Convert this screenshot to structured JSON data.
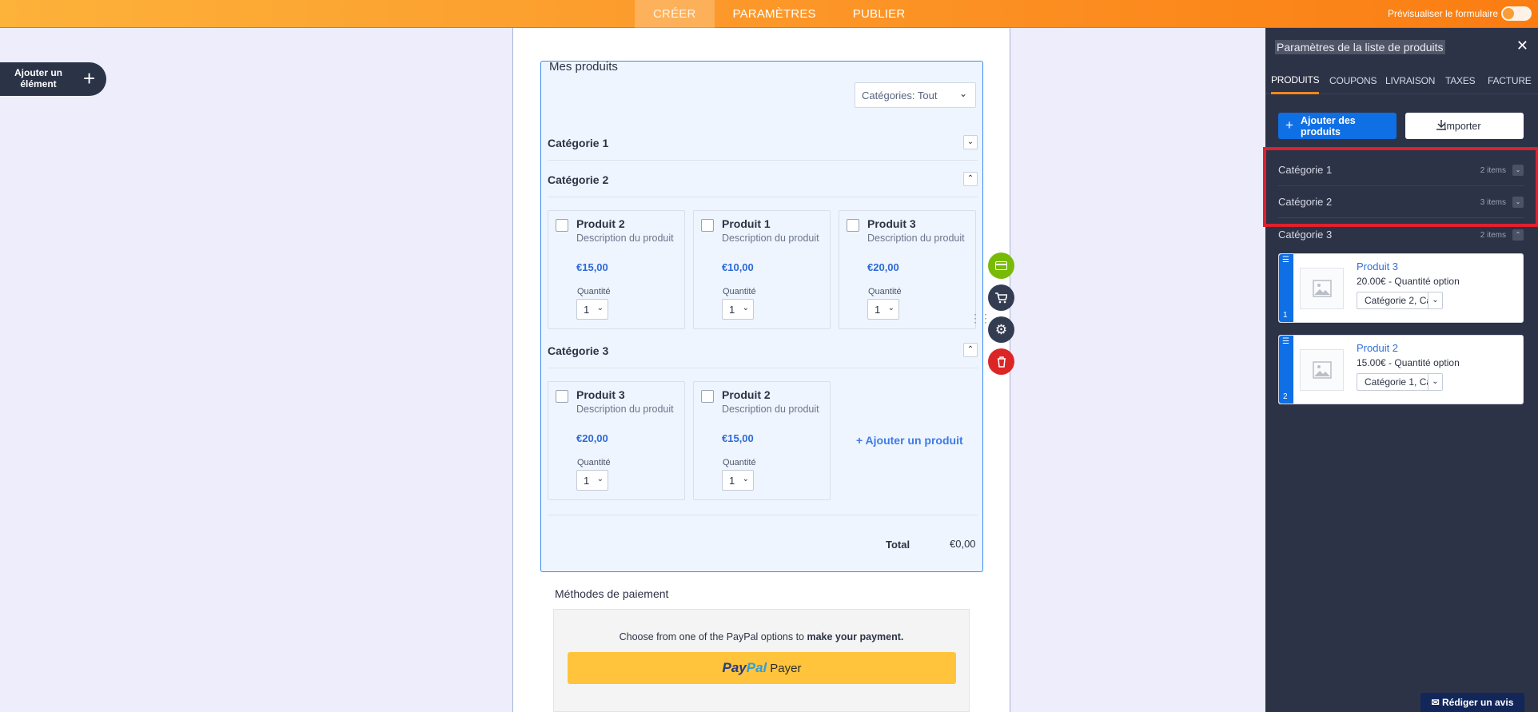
{
  "topbar": {
    "tabs": [
      {
        "label": "CRÉER",
        "active": true
      },
      {
        "label": "PARAMÈTRES",
        "active": false
      },
      {
        "label": "PUBLIER",
        "active": false
      }
    ],
    "preview_label": "Prévisualiser le formulaire",
    "gradient": [
      "#fdb23a",
      "#fb7d12"
    ]
  },
  "add_element": {
    "label": "Ajouter un élément",
    "icon": "plus-icon"
  },
  "widget": {
    "title": "Mes produits",
    "category_filter": "Catégories: Tout",
    "categories": [
      {
        "name": "Catégorie 1",
        "expanded": false,
        "products": []
      },
      {
        "name": "Catégorie 2",
        "expanded": true,
        "products": [
          {
            "name": "Produit 2",
            "description": "Description du produit",
            "price": "€15,00",
            "quantity_label": "Quantité",
            "quantity": "1"
          },
          {
            "name": "Produit 1",
            "description": "Description du produit",
            "price": "€10,00",
            "quantity_label": "Quantité",
            "quantity": "1"
          },
          {
            "name": "Produit 3",
            "description": "Description du produit",
            "price": "€20,00",
            "quantity_label": "Quantité",
            "quantity": "1"
          }
        ]
      },
      {
        "name": "Catégorie 3",
        "expanded": true,
        "products": [
          {
            "name": "Produit 3",
            "description": "Description du produit",
            "price": "€20,00",
            "quantity_label": "Quantité",
            "quantity": "1"
          },
          {
            "name": "Produit 2",
            "description": "Description du produit",
            "price": "€15,00",
            "quantity_label": "Quantité",
            "quantity": "1"
          }
        ]
      }
    ],
    "add_product": "+ Ajouter un produit",
    "total_label": "Total",
    "total_value": "€0,00"
  },
  "side_tools": [
    {
      "icon": "card-icon",
      "color": "#78bb07"
    },
    {
      "icon": "cart-icon",
      "color": "#343c52"
    },
    {
      "icon": "gear-icon",
      "color": "#343c52"
    },
    {
      "icon": "trash-icon",
      "color": "#dc2626"
    }
  ],
  "payment": {
    "title": "Méthodes de paiement",
    "text_prefix": "Choose from one of the PayPal options to ",
    "text_bold": "make your payment.",
    "paypal_brand_1": "Pay",
    "paypal_brand_2": "Pal",
    "paypal_action": "Payer",
    "button_color": "#ffc43b"
  },
  "panel": {
    "title": "Paramètres de la liste de produits",
    "tabs": [
      {
        "label": "PRODUITS",
        "active": true
      },
      {
        "label": "COUPONS",
        "active": false
      },
      {
        "label": "LIVRAISON",
        "active": false
      },
      {
        "label": "TAXES",
        "active": false
      },
      {
        "label": "FACTURE",
        "active": false
      }
    ],
    "add_products_label": "Ajouter des produits",
    "import_label": "Importer",
    "categories": [
      {
        "name": "Catégorie 1",
        "count": "2 items",
        "expanded": false
      },
      {
        "name": "Catégorie 2",
        "count": "3 items",
        "expanded": false
      },
      {
        "name": "Catégorie 3",
        "count": "2 items",
        "expanded": true
      }
    ],
    "cards": [
      {
        "index": "1",
        "name": "Produit 3",
        "subtitle": "20.00€ - Quantité option",
        "category": "Catégorie 2, Ca..."
      },
      {
        "index": "2",
        "name": "Produit 2",
        "subtitle": "15.00€ - Quantité option",
        "category": "Catégorie 1, Ca..."
      }
    ],
    "highlight_color": "#e0202e"
  },
  "review_button": "Rédiger un avis"
}
